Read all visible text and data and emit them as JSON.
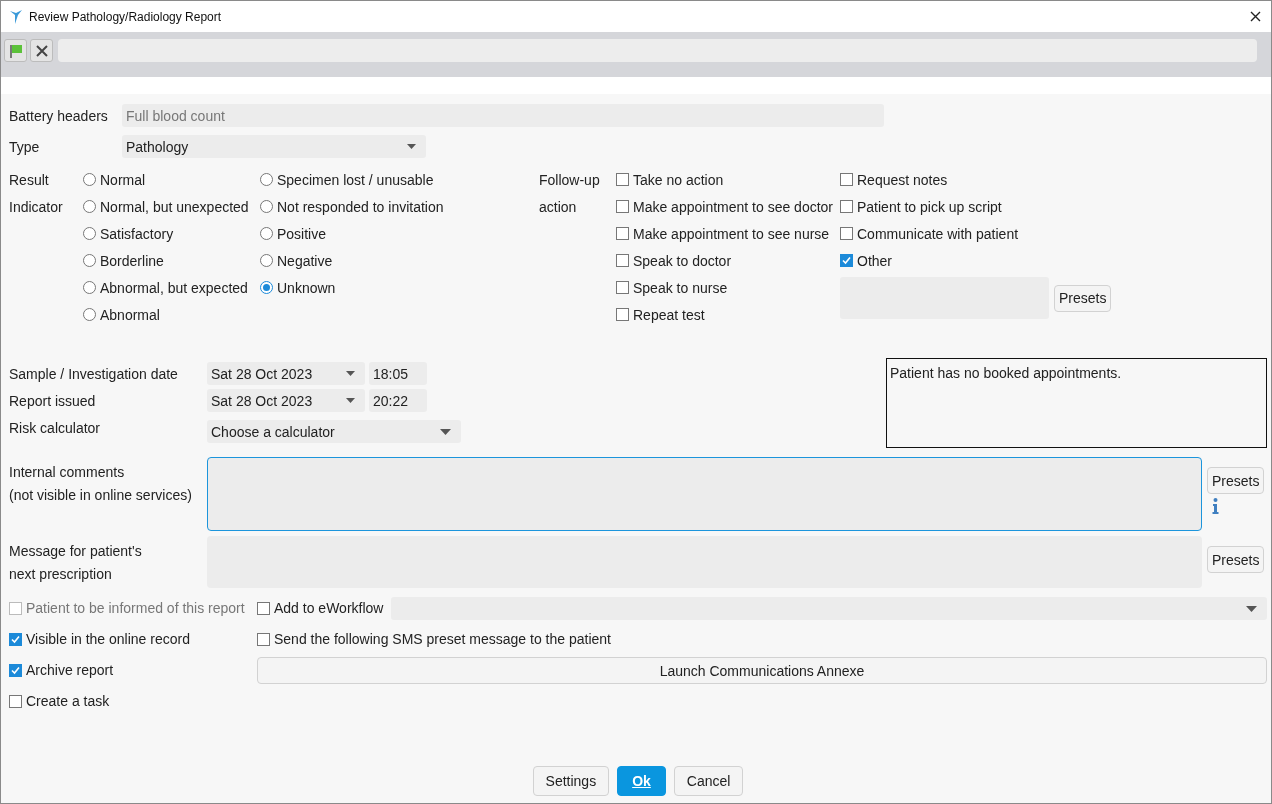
{
  "window": {
    "title": "Review Pathology/Radiology Report"
  },
  "battery_headers": {
    "label": "Battery headers",
    "value": "Full blood count",
    "disabled": true
  },
  "type": {
    "label": "Type",
    "value": "Pathology"
  },
  "result_indicator": {
    "label_lines": [
      "Result",
      "Indicator"
    ],
    "columns": [
      [
        {
          "label": "Normal",
          "selected": false
        },
        {
          "label": "Normal, but unexpected",
          "selected": false
        },
        {
          "label": "Satisfactory",
          "selected": false
        },
        {
          "label": "Borderline",
          "selected": false
        },
        {
          "label": "Abnormal, but expected",
          "selected": false
        },
        {
          "label": "Abnormal",
          "selected": false
        }
      ],
      [
        {
          "label": "Specimen lost / unusable",
          "selected": false
        },
        {
          "label": "Not responded to invitation",
          "selected": false
        },
        {
          "label": "Positive",
          "selected": false
        },
        {
          "label": "Negative",
          "selected": false
        },
        {
          "label": "Unknown",
          "selected": true
        }
      ]
    ]
  },
  "follow_up": {
    "label_lines": [
      "Follow-up",
      "action"
    ],
    "columns": [
      [
        {
          "label": "Take no action",
          "checked": false
        },
        {
          "label": "Make appointment to see doctor",
          "checked": false
        },
        {
          "label": "Make appointment to see nurse",
          "checked": false
        },
        {
          "label": "Speak to doctor",
          "checked": false
        },
        {
          "label": "Speak to nurse",
          "checked": false
        },
        {
          "label": "Repeat test",
          "checked": false
        }
      ],
      [
        {
          "label": "Request notes",
          "checked": false
        },
        {
          "label": "Patient to pick up script",
          "checked": false
        },
        {
          "label": "Communicate with patient",
          "checked": false
        },
        {
          "label": "Other",
          "checked": true
        }
      ]
    ],
    "presets": "Presets"
  },
  "dates": [
    {
      "label": "Sample / Investigation date",
      "date": "Sat 28 Oct 2023",
      "time": "18:05"
    },
    {
      "label": "Report issued",
      "date": "Sat 28 Oct 2023",
      "time": "20:22"
    }
  ],
  "risk_calculator": {
    "label": "Risk calculator",
    "value": "Choose a calculator"
  },
  "appointments_note": "Patient has no booked appointments.",
  "internal_comments": {
    "label_lines": [
      "Internal comments",
      "(not visible in online services)"
    ],
    "focused": true,
    "presets": "Presets"
  },
  "patient_message": {
    "label_lines": [
      "Message for patient's",
      "next prescription"
    ],
    "focused": false,
    "presets": "Presets"
  },
  "options_left": [
    {
      "label": "Patient to be informed of this report",
      "checked": false,
      "disabled": true
    },
    {
      "label": "Visible in the online record",
      "checked": true,
      "disabled": false
    },
    {
      "label": "Archive report",
      "checked": true,
      "disabled": false
    },
    {
      "label": "Create a task",
      "checked": false,
      "disabled": false
    }
  ],
  "eworkflow": {
    "label": "Add to eWorkflow",
    "checked": false
  },
  "sms": {
    "label": "Send the following SMS preset message to the patient",
    "checked": false
  },
  "launch_button": "Launch Communications Annexe",
  "buttons": [
    {
      "label": "Settings",
      "kind": "default"
    },
    {
      "label": "Ok",
      "kind": "primary"
    },
    {
      "label": "Cancel",
      "kind": "cancel"
    }
  ]
}
